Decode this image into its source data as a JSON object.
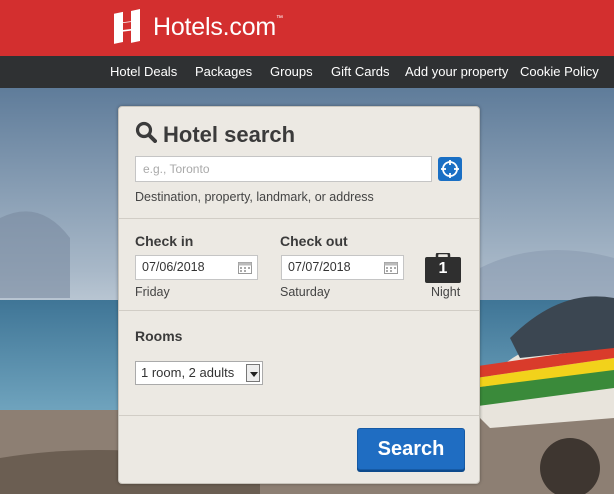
{
  "brand": {
    "name": "Hotels.com",
    "tm": "™"
  },
  "nav": {
    "items": [
      {
        "label": "Hotel Deals"
      },
      {
        "label": "Packages"
      },
      {
        "label": "Groups"
      },
      {
        "label": "Gift Cards"
      },
      {
        "label": "Add your property"
      },
      {
        "label": "Cookie Policy"
      }
    ]
  },
  "search": {
    "title": "Hotel search",
    "destination_placeholder": "e.g., Toronto",
    "destination_value": "",
    "destination_hint": "Destination, property, landmark, or address",
    "checkin_label": "Check in",
    "checkin_value": "07/06/2018",
    "checkin_day": "Friday",
    "checkout_label": "Check out",
    "checkout_value": "07/07/2018",
    "checkout_day": "Saturday",
    "nights_count": "1",
    "nights_label": "Night",
    "rooms_label": "Rooms",
    "rooms_value": "1 room, 2 adults",
    "submit_label": "Search"
  },
  "colors": {
    "brand_red": "#d32f2f",
    "nav_bg": "#2f3133",
    "accent_blue": "#1f6dc2"
  }
}
